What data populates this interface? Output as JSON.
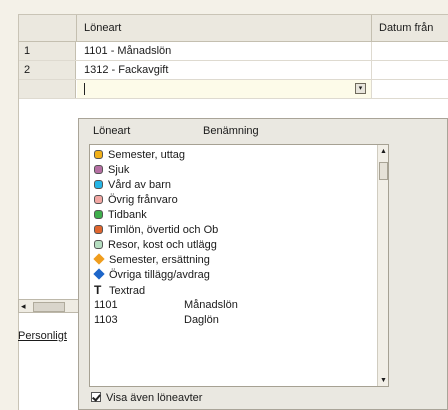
{
  "grid": {
    "columns": [
      "Löneart",
      "Datum från"
    ],
    "rows": [
      {
        "num": "1",
        "value": "1101 - Månadslön"
      },
      {
        "num": "2",
        "value": "1312 - Fackavgift"
      }
    ]
  },
  "left_panel": {
    "label": "Personligt"
  },
  "dropdown": {
    "headers": [
      "Löneart",
      "Benämning"
    ],
    "items": [
      {
        "icon": "circle",
        "color": "#f1b019",
        "label": "Semester, uttag"
      },
      {
        "icon": "circle",
        "color": "#b56fa3",
        "label": "Sjuk"
      },
      {
        "icon": "circle",
        "color": "#25b5e6",
        "label": "Vård av barn"
      },
      {
        "icon": "circle",
        "color": "#f2a7a3",
        "label": "Övrig frånvaro"
      },
      {
        "icon": "circle",
        "color": "#3fae4c",
        "label": "Tidbank"
      },
      {
        "icon": "circle",
        "color": "#e0662e",
        "label": "Timlön, övertid och Ob"
      },
      {
        "icon": "circle",
        "color": "#b5ddc0",
        "label": "Resor, kost och utlägg"
      },
      {
        "icon": "diamond",
        "color": "#ef9d1e",
        "label": "Semester, ersättning"
      },
      {
        "icon": "diamond",
        "color": "#1d66c9",
        "label": "Övriga tillägg/avdrag"
      },
      {
        "icon": "text",
        "label": "Textrad"
      },
      {
        "code": "1101",
        "name": "Månadslön"
      },
      {
        "code": "1103",
        "name": "Daglön"
      }
    ],
    "checkbox_label": "Visa även löneavter",
    "checkbox_checked": true
  }
}
